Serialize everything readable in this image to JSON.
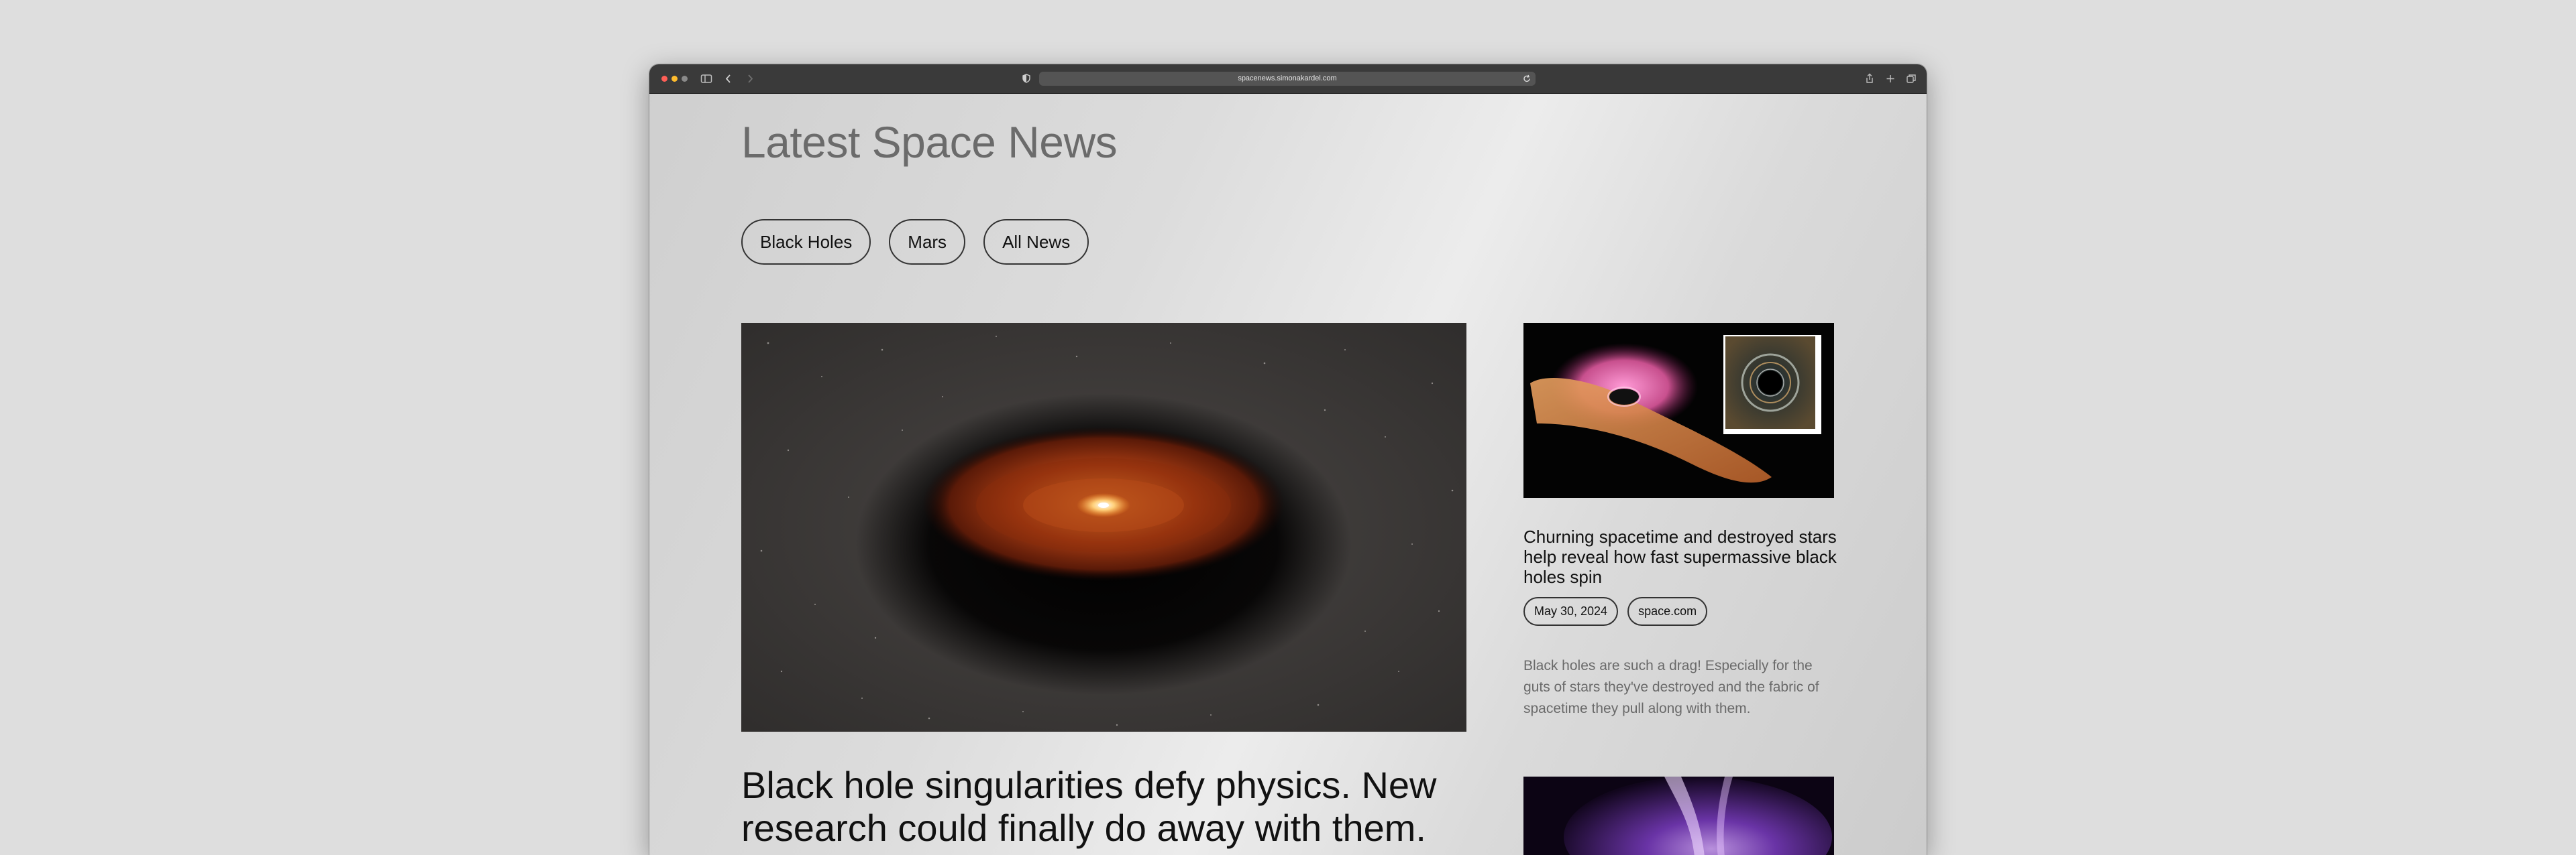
{
  "browser": {
    "url": "spacenews.simonakardel.com",
    "colors": {
      "close": "#ff5f57",
      "minimize": "#febc2e",
      "zoom": "#8a8a8a",
      "titlebar": "#3a3a3a"
    },
    "icons": [
      "sidebar-icon",
      "back-icon",
      "forward-icon",
      "shield-icon",
      "reload-icon",
      "share-icon",
      "new-tab-icon",
      "tabs-overview-icon"
    ]
  },
  "page": {
    "title": "Latest Space News",
    "filters": [
      "Black Holes",
      "Mars",
      "All News"
    ]
  },
  "featured": {
    "title": "Black hole singularities defy physics. New research could finally do away with them."
  },
  "sidebar_article": {
    "title": "Churning spacetime and destroyed stars help reveal how fast supermassive black holes spin",
    "date": "May 30, 2024",
    "source": "space.com",
    "description": "Black holes are such a drag! Especially for the guts of stars they've destroyed and the fabric of spacetime they pull along with them."
  }
}
